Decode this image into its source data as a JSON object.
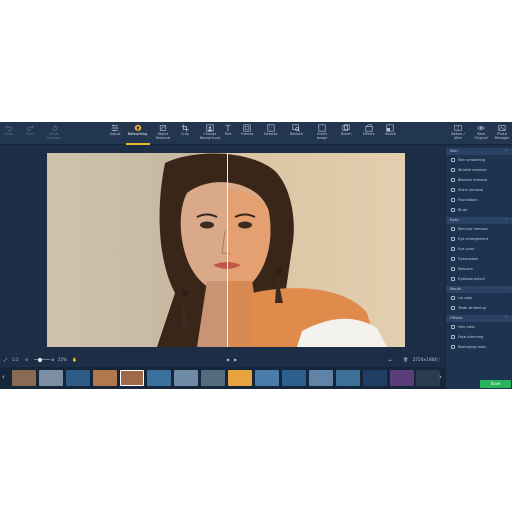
{
  "toolbar": {
    "left": [
      {
        "label": "Undo",
        "icon": "undo-icon"
      },
      {
        "label": "Redo",
        "icon": "redo-icon"
      },
      {
        "label": "Reset Changes",
        "icon": "reset-icon"
      }
    ],
    "tools": [
      {
        "label": "Adjust",
        "icon": "sliders-icon"
      },
      {
        "label": "Retouching",
        "icon": "retouch-icon",
        "active": true
      },
      {
        "label": "Object Removal",
        "icon": "eraser-icon"
      },
      {
        "label": "Crop",
        "icon": "crop-icon"
      },
      {
        "label": "Change Background",
        "icon": "background-icon"
      },
      {
        "label": "Text",
        "icon": "text-icon"
      },
      {
        "label": "Frames",
        "icon": "frame-icon"
      },
      {
        "label": "Denoise",
        "icon": "denoise-icon"
      },
      {
        "label": "Restore",
        "icon": "restore-icon"
      },
      {
        "label": "Insert Image",
        "icon": "insert-image-icon"
      },
      {
        "label": "Bokeh",
        "icon": "bokeh-icon"
      },
      {
        "label": "Effects",
        "icon": "effects-icon"
      },
      {
        "label": "Resize",
        "icon": "resize-icon"
      }
    ],
    "right": [
      {
        "label": "Before / After",
        "icon": "before-after-icon"
      },
      {
        "label": "View Original",
        "icon": "eye-icon"
      },
      {
        "label": "Photo Manager",
        "icon": "photo-manager-icon"
      }
    ],
    "accent_color": "#f1b233"
  },
  "panel": {
    "sections": [
      {
        "title": "Skin",
        "items": [
          "Skin smoothing",
          "Wrinkle removal",
          "Blemish removal",
          "Shine removal",
          "Foundation",
          "Blush"
        ]
      },
      {
        "title": "Eyes",
        "items": [
          "Red-eye removal",
          "Eye enlargement",
          "Eye color",
          "Eyeshadow",
          "Mascara",
          "Eyebrow pencil"
        ]
      },
      {
        "title": "Mouth",
        "items": [
          "Lip color",
          "Teeth whitening"
        ]
      },
      {
        "title": "Others",
        "items": [
          "Hair color",
          "Face slimming",
          "Reshaping tools"
        ]
      }
    ],
    "save_label": "Save"
  },
  "controls": {
    "fit_label": "1:1",
    "zoom_percent": "25%",
    "resolution": "2724×1804"
  }
}
